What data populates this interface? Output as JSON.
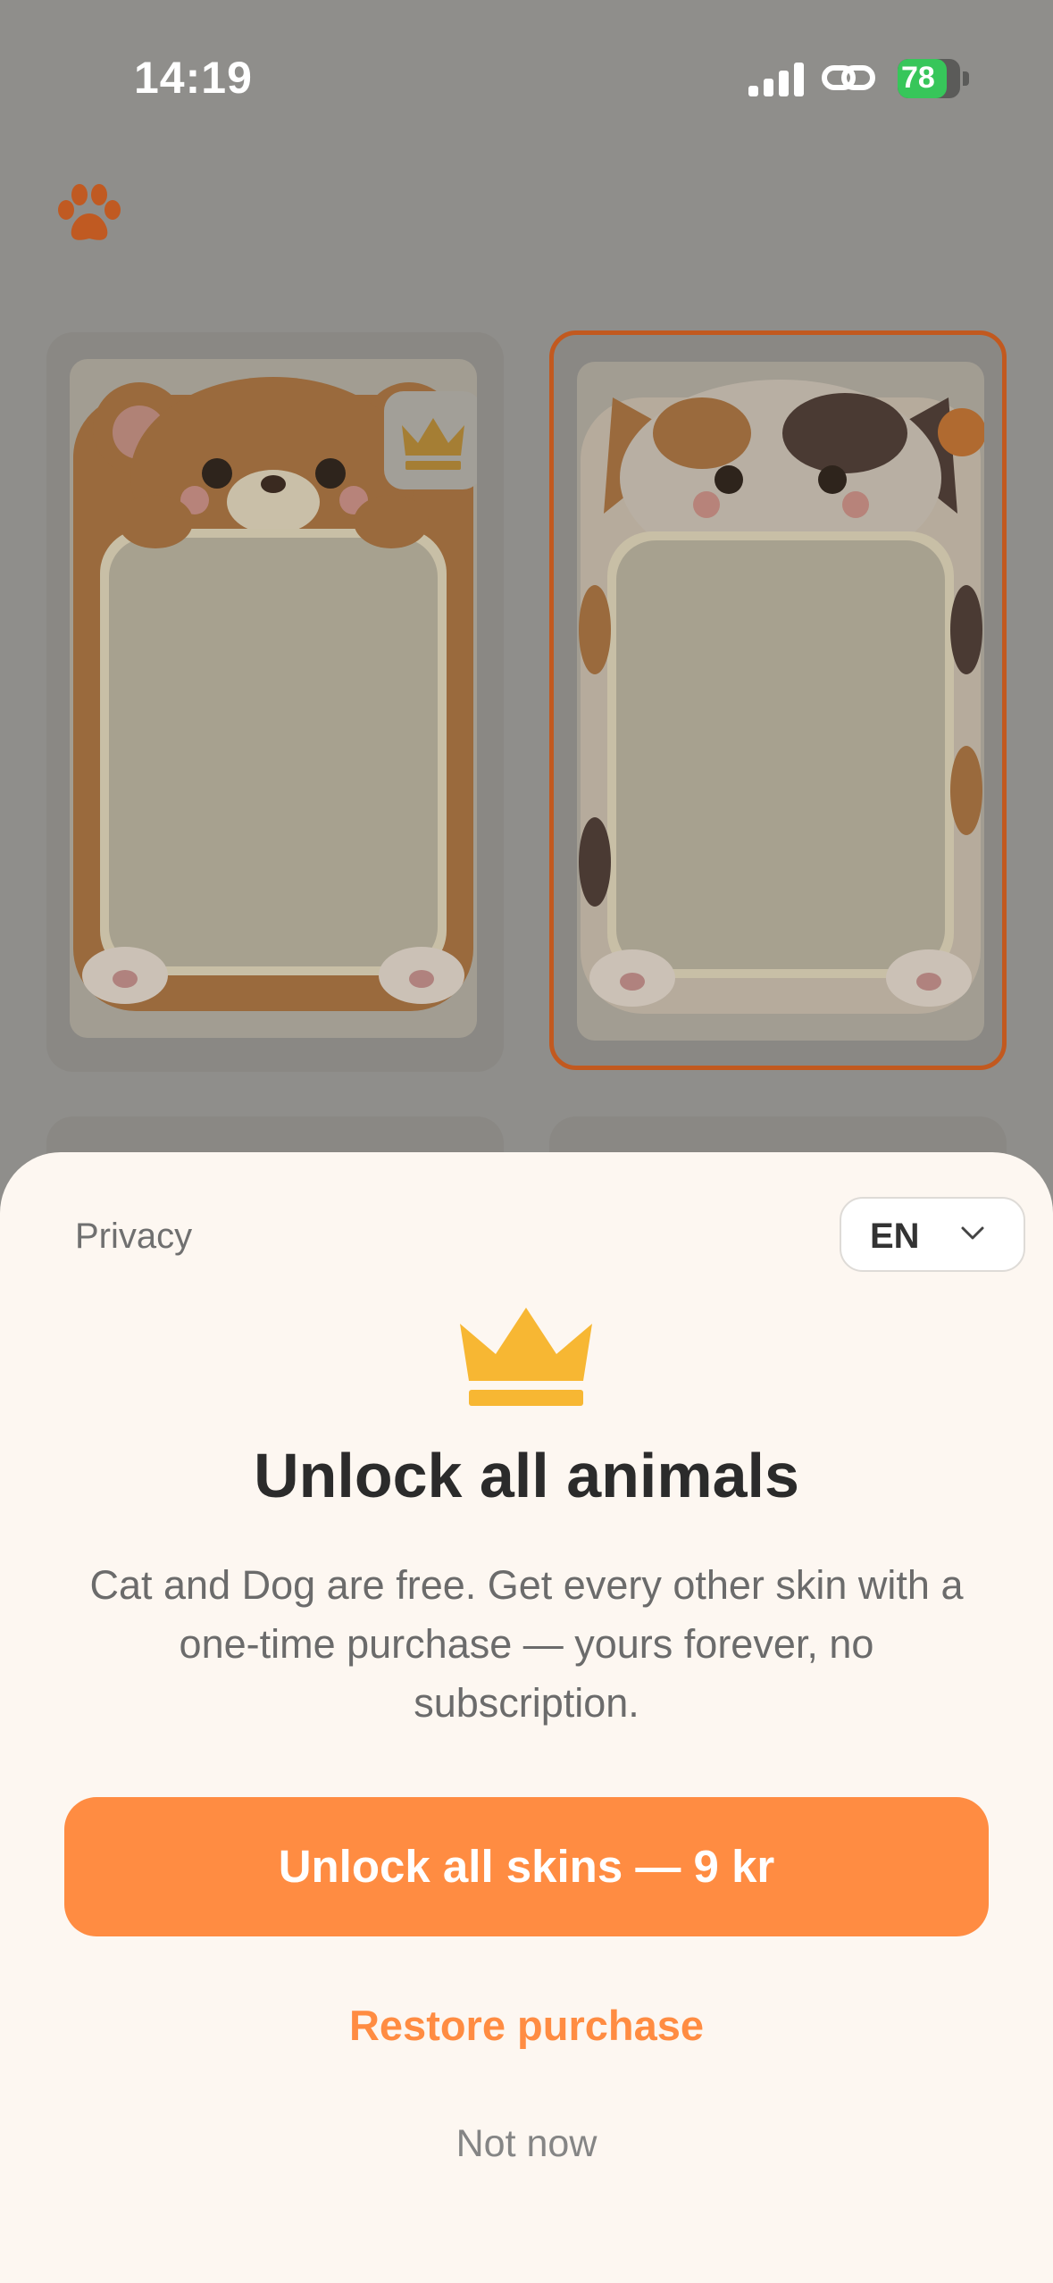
{
  "status_bar": {
    "time": "14:19",
    "battery": "78",
    "battery_level": 0.78
  },
  "skins": [
    {
      "name": "Bear",
      "locked": true,
      "selected": false
    },
    {
      "name": "Cat",
      "locked": false,
      "selected": true
    }
  ],
  "sheet": {
    "privacy": "Privacy",
    "language": "EN",
    "title": "Unlock all animals",
    "description": "Cat and Dog are free. Get every other skin with a one-time purchase — yours forever, no subscription.",
    "cta": "Unlock all skins — 9 kr",
    "restore": "Restore purchase",
    "dismiss": "Not now"
  },
  "colors": {
    "accent": "#ff8c42",
    "sheet_bg": "#fdf7f1",
    "crown": "#f7b733",
    "selected_border": "#c2591f"
  }
}
